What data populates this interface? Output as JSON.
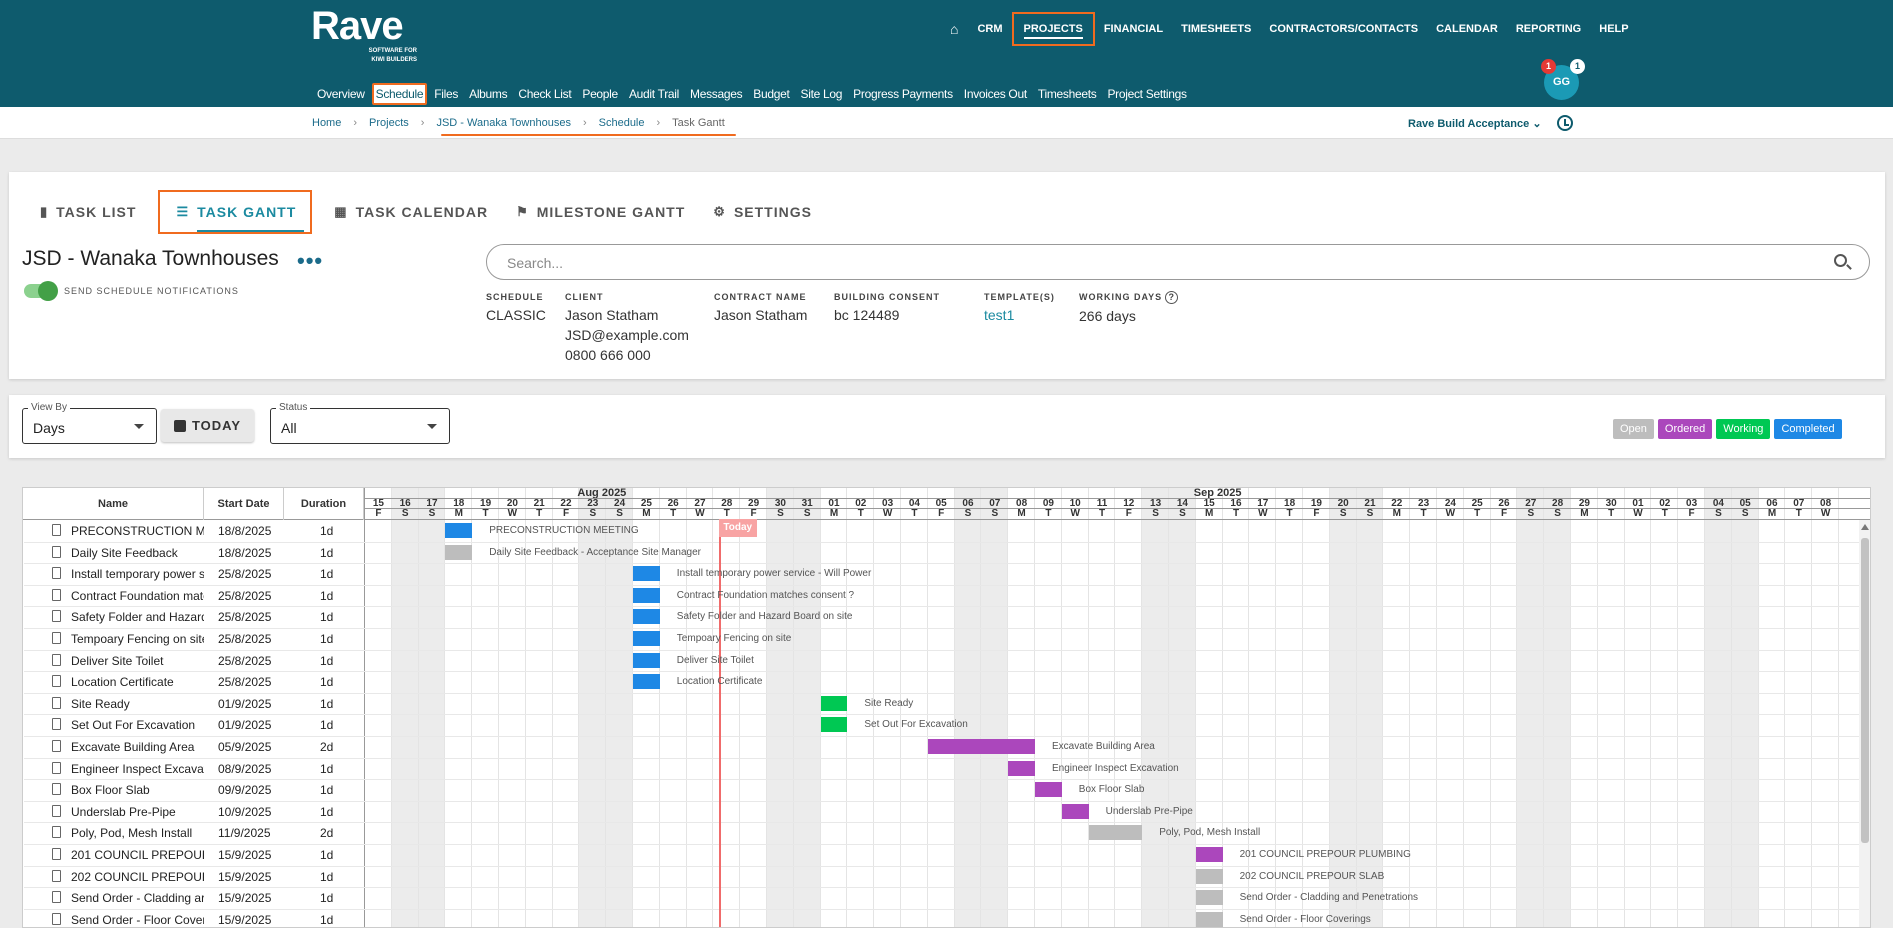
{
  "app": {
    "logo": "Rave",
    "logo_tagline_1": "SOFTWARE FOR",
    "logo_tagline_2": "KIWI BUILDERS"
  },
  "top_nav": [
    "CRM",
    "PROJECTS",
    "FINANCIAL",
    "TIMESHEETS",
    "CONTRACTORS/CONTACTS",
    "CALENDAR",
    "REPORTING",
    "HELP"
  ],
  "sub_nav": [
    "Overview",
    "Schedule",
    "Files",
    "Albums",
    "Check List",
    "People",
    "Audit Trail",
    "Messages",
    "Budget",
    "Site Log",
    "Progress Payments",
    "Invoices Out",
    "Timesheets",
    "Project Settings"
  ],
  "user": {
    "initials": "GG",
    "notif_red": "1",
    "notif_white": "1"
  },
  "breadcrumb": [
    "Home",
    "Projects",
    "JSD - Wanaka Townhouses",
    "Schedule",
    "Task Gantt"
  ],
  "account": "Rave Build Acceptance",
  "tabs": [
    "TASK LIST",
    "TASK GANTT",
    "TASK CALENDAR",
    "MILESTONE GANTT",
    "SETTINGS"
  ],
  "project": {
    "title": "JSD - Wanaka Townhouses",
    "notifications_label": "SEND SCHEDULE NOTIFICATIONS",
    "search_placeholder": "Search...",
    "schedule_label": "SCHEDULE",
    "schedule": "CLASSIC",
    "client_label": "CLIENT",
    "client_name": "Jason Statham",
    "client_email": "JSD@example.com",
    "client_phone": "0800 666 000",
    "contract_label": "CONTRACT NAME",
    "contract": "Jason Statham",
    "consent_label": "BUILDING CONSENT",
    "consent": "bc 124489",
    "templates_label": "TEMPLATE(S)",
    "templates": "test1",
    "working_label": "WORKING DAYS",
    "working": "266 days"
  },
  "filters": {
    "view_by_label": "View By",
    "view_by": "Days",
    "today_label": "TODAY",
    "status_label": "Status",
    "status": "All"
  },
  "legend": [
    {
      "label": "Open",
      "color": "#bdbdbd"
    },
    {
      "label": "Ordered",
      "color": "#ab47bc"
    },
    {
      "label": "Working",
      "color": "#00c853"
    },
    {
      "label": "Completed",
      "color": "#1e88e5"
    }
  ],
  "table": {
    "headers": [
      "Name",
      "Start Date",
      "Duration"
    ]
  },
  "gantt": {
    "months": [
      {
        "label": "Aug 2025",
        "start": 8
      },
      {
        "label": "Sep 2025",
        "start": 31
      }
    ],
    "today_label": "Today",
    "today_index": 13.2,
    "days": [
      [
        "15",
        "F"
      ],
      [
        "16",
        "S"
      ],
      [
        "17",
        "S"
      ],
      [
        "18",
        "M"
      ],
      [
        "19",
        "T"
      ],
      [
        "20",
        "W"
      ],
      [
        "21",
        "T"
      ],
      [
        "22",
        "F"
      ],
      [
        "23",
        "S"
      ],
      [
        "24",
        "S"
      ],
      [
        "25",
        "M"
      ],
      [
        "26",
        "T"
      ],
      [
        "27",
        "W"
      ],
      [
        "28",
        "T"
      ],
      [
        "29",
        "F"
      ],
      [
        "30",
        "S"
      ],
      [
        "31",
        "S"
      ],
      [
        "01",
        "M"
      ],
      [
        "02",
        "T"
      ],
      [
        "03",
        "W"
      ],
      [
        "04",
        "T"
      ],
      [
        "05",
        "F"
      ],
      [
        "06",
        "S"
      ],
      [
        "07",
        "S"
      ],
      [
        "08",
        "M"
      ],
      [
        "09",
        "T"
      ],
      [
        "10",
        "W"
      ],
      [
        "11",
        "T"
      ],
      [
        "12",
        "F"
      ],
      [
        "13",
        "S"
      ],
      [
        "14",
        "S"
      ],
      [
        "15",
        "M"
      ],
      [
        "16",
        "T"
      ],
      [
        "17",
        "W"
      ],
      [
        "18",
        "T"
      ],
      [
        "19",
        "F"
      ],
      [
        "20",
        "S"
      ],
      [
        "21",
        "S"
      ],
      [
        "22",
        "M"
      ],
      [
        "23",
        "T"
      ],
      [
        "24",
        "W"
      ],
      [
        "25",
        "T"
      ],
      [
        "26",
        "F"
      ],
      [
        "27",
        "S"
      ],
      [
        "28",
        "S"
      ],
      [
        "29",
        "M"
      ],
      [
        "30",
        "T"
      ],
      [
        "01",
        "W"
      ],
      [
        "02",
        "T"
      ],
      [
        "03",
        "F"
      ],
      [
        "04",
        "S"
      ],
      [
        "05",
        "S"
      ],
      [
        "06",
        "M"
      ],
      [
        "07",
        "T"
      ],
      [
        "08",
        "W"
      ]
    ]
  },
  "tasks": [
    {
      "name": "PRECONSTRUCTION M",
      "full": "PRECONSTRUCTION MEETING",
      "start": "18/8/2025",
      "duration": "1d",
      "day": 3,
      "len": 1,
      "status": "Completed"
    },
    {
      "name": "Daily Site Feedback",
      "full": "Daily Site Feedback - Acceptance Site Manager",
      "start": "18/8/2025",
      "duration": "1d",
      "day": 3,
      "len": 1,
      "status": "Open"
    },
    {
      "name": "Install temporary power s",
      "full": "Install temporary power service - Will Power",
      "start": "25/8/2025",
      "duration": "1d",
      "day": 10,
      "len": 1,
      "status": "Completed"
    },
    {
      "name": "Contract Foundation matc",
      "full": "Contract Foundation matches consent ?",
      "start": "25/8/2025",
      "duration": "1d",
      "day": 10,
      "len": 1,
      "status": "Completed"
    },
    {
      "name": "Safety Folder and Hazard",
      "full": "Safety Folder and Hazard Board on site",
      "start": "25/8/2025",
      "duration": "1d",
      "day": 10,
      "len": 1,
      "status": "Completed"
    },
    {
      "name": "Tempoary Fencing on site",
      "full": "Tempoary Fencing on site",
      "start": "25/8/2025",
      "duration": "1d",
      "day": 10,
      "len": 1,
      "status": "Completed"
    },
    {
      "name": "Deliver Site Toilet",
      "full": "Deliver Site Toilet",
      "start": "25/8/2025",
      "duration": "1d",
      "day": 10,
      "len": 1,
      "status": "Completed"
    },
    {
      "name": "Location Certificate",
      "full": "Location Certificate",
      "start": "25/8/2025",
      "duration": "1d",
      "day": 10,
      "len": 1,
      "status": "Completed"
    },
    {
      "name": "Site Ready",
      "full": "Site Ready",
      "start": "01/9/2025",
      "duration": "1d",
      "day": 17,
      "len": 1,
      "status": "Working"
    },
    {
      "name": "Set Out For Excavation",
      "full": "Set Out For Excavation",
      "start": "01/9/2025",
      "duration": "1d",
      "day": 17,
      "len": 1,
      "status": "Working"
    },
    {
      "name": "Excavate Building Area",
      "full": "Excavate Building Area",
      "start": "05/9/2025",
      "duration": "2d",
      "day": 21,
      "len": 4,
      "status": "Ordered"
    },
    {
      "name": "Engineer Inspect Excavat",
      "full": "Engineer Inspect Excavation",
      "start": "08/9/2025",
      "duration": "1d",
      "day": 24,
      "len": 1,
      "status": "Ordered"
    },
    {
      "name": "Box Floor Slab",
      "full": "Box Floor Slab",
      "start": "09/9/2025",
      "duration": "1d",
      "day": 25,
      "len": 1,
      "status": "Ordered"
    },
    {
      "name": "Underslab Pre-Pipe",
      "full": "Underslab Pre-Pipe",
      "start": "10/9/2025",
      "duration": "1d",
      "day": 26,
      "len": 1,
      "status": "Ordered"
    },
    {
      "name": "Poly, Pod, Mesh Install",
      "full": "Poly, Pod, Mesh Install",
      "start": "11/9/2025",
      "duration": "2d",
      "day": 27,
      "len": 2,
      "status": "Open"
    },
    {
      "name": "201 COUNCIL PREPOUF",
      "full": "201 COUNCIL PREPOUR PLUMBING",
      "start": "15/9/2025",
      "duration": "1d",
      "day": 31,
      "len": 1,
      "status": "Ordered"
    },
    {
      "name": "202 COUNCIL PREPOUF",
      "full": "202 COUNCIL PREPOUR SLAB",
      "start": "15/9/2025",
      "duration": "1d",
      "day": 31,
      "len": 1,
      "status": "Open"
    },
    {
      "name": "Send Order - Cladding ar",
      "full": "Send Order - Cladding and Penetrations",
      "start": "15/9/2025",
      "duration": "1d",
      "day": 31,
      "len": 1,
      "status": "Open"
    },
    {
      "name": "Send Order - Floor Cover",
      "full": "Send Order - Floor Coverings",
      "start": "15/9/2025",
      "duration": "1d",
      "day": 31,
      "len": 1,
      "status": "Open"
    }
  ]
}
